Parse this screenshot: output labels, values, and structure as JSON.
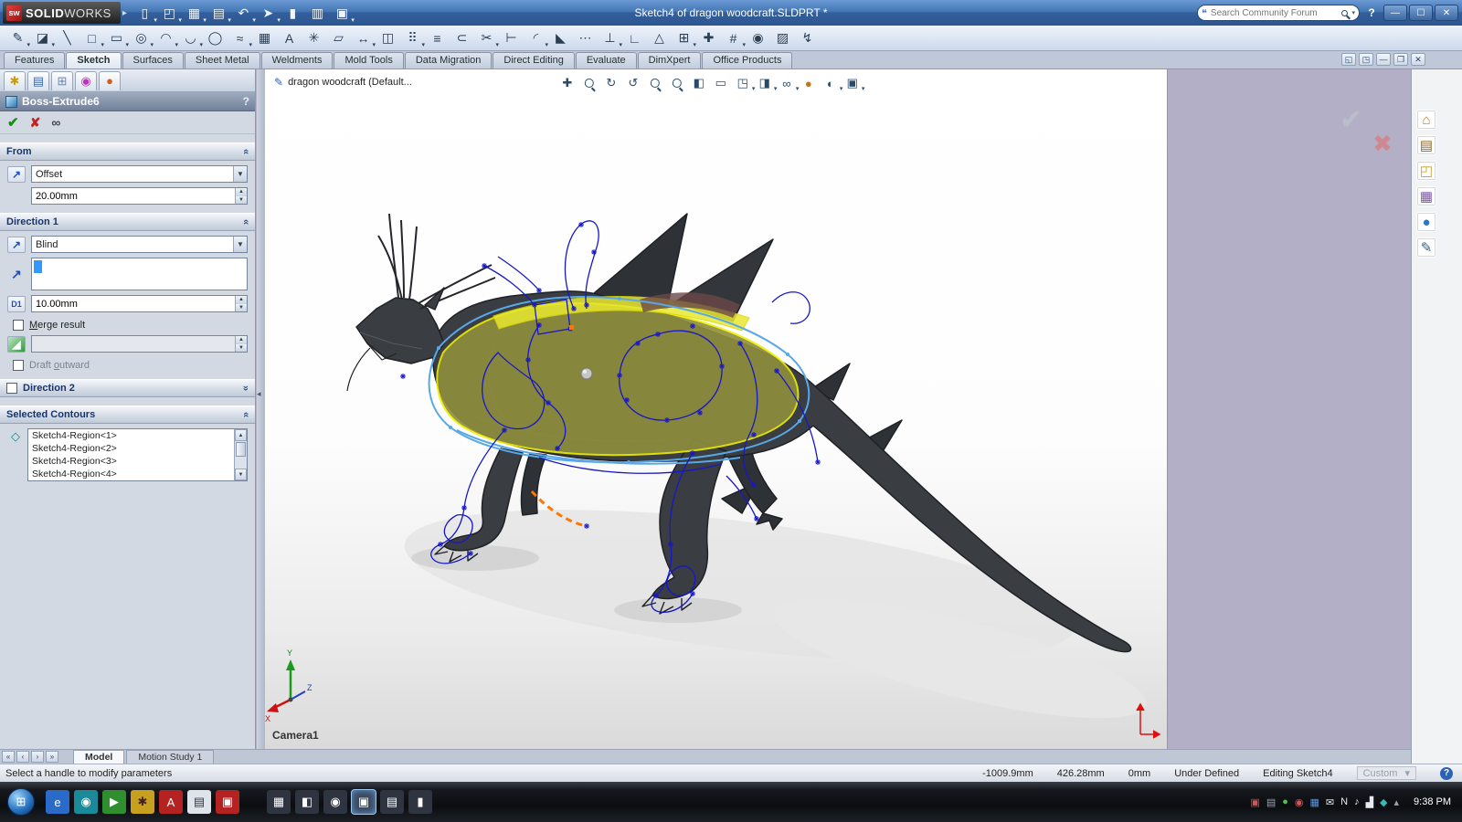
{
  "titlebar": {
    "logo": {
      "badge": "sw",
      "name_bold": "SOLID",
      "name_light": "WORKS",
      "arrow": "▸"
    },
    "doc_title": "Sketch4 of dragon woodcraft.SLDPRT *",
    "search_placeholder": "Search Community Forum",
    "bubble_glyph": "❝",
    "help_glyph": "?",
    "quick": [
      {
        "name": "new-document-icon",
        "glyph": "▯",
        "v": "arr"
      },
      {
        "name": "open-icon",
        "glyph": "◰",
        "v": "arr"
      },
      {
        "name": "save-icon",
        "glyph": "▦",
        "v": "arr"
      },
      {
        "name": "print-icon",
        "glyph": "▤",
        "v": "arr"
      },
      {
        "name": "undo-icon",
        "glyph": "↶",
        "v": "arr"
      },
      {
        "name": "select-icon",
        "glyph": "➤",
        "v": "arr"
      },
      {
        "name": "rebuild-icon",
        "glyph": "▮",
        "v": ""
      },
      {
        "name": "file-properties-icon",
        "glyph": "▥",
        "v": ""
      },
      {
        "name": "options-icon",
        "glyph": "▣",
        "v": "arr"
      }
    ],
    "window_buttons": [
      {
        "name": "minimize-button",
        "glyph": "—"
      },
      {
        "name": "maximize-button",
        "glyph": "☐"
      },
      {
        "name": "close-button",
        "glyph": "✕"
      }
    ]
  },
  "sketch_toolbar": {
    "icons": [
      {
        "name": "exit-sketch-icon",
        "glyph": "✎",
        "v": "arr"
      },
      {
        "name": "eraser-icon",
        "glyph": "◪",
        "v": "arr"
      },
      {
        "name": "line-icon",
        "glyph": "╲",
        "v": ""
      },
      {
        "name": "rectangle-icon",
        "glyph": "□",
        "v": "arr"
      },
      {
        "name": "slot-icon",
        "glyph": "▭",
        "v": "arr"
      },
      {
        "name": "circle-icon",
        "glyph": "◎",
        "v": "arr"
      },
      {
        "name": "arc-icon",
        "glyph": "◠",
        "v": "arr"
      },
      {
        "name": "three-point-arc-icon",
        "glyph": "◡",
        "v": "arr"
      },
      {
        "name": "ellipse-icon",
        "glyph": "◯",
        "v": ""
      },
      {
        "name": "spline-icon",
        "glyph": "≈",
        "v": "arr"
      },
      {
        "name": "grid-icon",
        "glyph": "▦",
        "v": ""
      },
      {
        "name": "text-icon",
        "glyph": "A",
        "v": ""
      },
      {
        "name": "point-icon",
        "glyph": "✳",
        "v": ""
      },
      {
        "name": "plane-icon",
        "glyph": "▱",
        "v": ""
      },
      {
        "name": "smart-dimension-icon",
        "glyph": "↔",
        "v": "arr"
      },
      {
        "name": "mirror-entities-icon",
        "glyph": "◫",
        "v": ""
      },
      {
        "name": "linear-pattern-icon",
        "glyph": "⠿",
        "v": "arr"
      },
      {
        "name": "offset-entities-icon",
        "glyph": "≡",
        "v": ""
      },
      {
        "name": "convert-entities-icon",
        "glyph": "⊂",
        "v": ""
      },
      {
        "name": "trim-entities-icon",
        "glyph": "✂",
        "v": "arr"
      },
      {
        "name": "extend-entities-icon",
        "glyph": "⊢",
        "v": ""
      },
      {
        "name": "fillet-icon",
        "glyph": "◜",
        "v": "arr"
      },
      {
        "name": "chamfer-icon",
        "glyph": "◣",
        "v": ""
      },
      {
        "name": "construction-geometry-icon",
        "glyph": "⋯",
        "v": ""
      },
      {
        "name": "display-relations-icon",
        "glyph": "⊥",
        "v": "arr"
      },
      {
        "name": "add-relation-icon",
        "glyph": "∟",
        "v": ""
      },
      {
        "name": "sketch-warning-icon",
        "glyph": "△",
        "v": ""
      },
      {
        "name": "pattern-icon",
        "glyph": "⊞",
        "v": "arr"
      },
      {
        "name": "snap-icon",
        "glyph": "✚",
        "v": ""
      },
      {
        "name": "quick-snaps-icon",
        "glyph": "#",
        "v": "arr"
      },
      {
        "name": "record-macro-icon",
        "glyph": "◉",
        "v": "red"
      },
      {
        "name": "sketch-picture-icon",
        "glyph": "▨",
        "v": ""
      },
      {
        "name": "instant3d-icon",
        "glyph": "↯",
        "v": "yellow"
      }
    ]
  },
  "ribbon": {
    "tabs": [
      {
        "label": "Features",
        "v": ""
      },
      {
        "label": "Sketch",
        "v": "active"
      },
      {
        "label": "Surfaces",
        "v": ""
      },
      {
        "label": "Sheet Metal",
        "v": ""
      },
      {
        "label": "Weldments",
        "v": ""
      },
      {
        "label": "Mold Tools",
        "v": ""
      },
      {
        "label": "Data Migration",
        "v": ""
      },
      {
        "label": "Direct Editing",
        "v": ""
      },
      {
        "label": "Evaluate",
        "v": ""
      },
      {
        "label": "DimXpert",
        "v": ""
      },
      {
        "label": "Office Products",
        "v": ""
      }
    ],
    "child_controls": [
      {
        "name": "dock-pane-icon",
        "glyph": "◱"
      },
      {
        "name": "expand-pane-icon",
        "glyph": "◳"
      },
      {
        "name": "child-minimize-button",
        "glyph": "—"
      },
      {
        "name": "child-restore-button",
        "glyph": "❐"
      },
      {
        "name": "child-close-button",
        "glyph": "✕"
      }
    ]
  },
  "property_manager": {
    "tab_icons": [
      {
        "name": "feature-manager-tab",
        "glyph": "✱",
        "color": "#c89c10"
      },
      {
        "name": "property-manager-tab",
        "glyph": "▤",
        "color": "#3a68a8"
      },
      {
        "name": "configuration-manager-tab",
        "glyph": "⊞",
        "color": "#6a85ad"
      },
      {
        "name": "dimxpert-manager-tab",
        "glyph": "◉",
        "color": "#c030c0"
      },
      {
        "name": "display-manager-tab",
        "glyph": "●",
        "color": "#d06020"
      }
    ],
    "header": {
      "title": "Boss-Extrude6",
      "help": "?"
    },
    "actions": {
      "ok": "✔",
      "cancel": "✘",
      "preview": "∞"
    },
    "from": {
      "label": "From",
      "option": "Offset",
      "offset_value": "20.00mm"
    },
    "direction1": {
      "label": "Direction 1",
      "option": "Blind",
      "dir_arrow": "↗",
      "depth_icon": "D1",
      "depth_value": "10.00mm",
      "merge": {
        "pre": "",
        "k": "M",
        "rest": "erge result"
      },
      "draft": {
        "pre": "Draft ",
        "k": "o",
        "rest": "utward"
      }
    },
    "direction2": {
      "label": "Direction 2"
    },
    "contours": {
      "label": "Selected Contours",
      "items": [
        "Sketch4-Region<1>",
        "Sketch4-Region<2>",
        "Sketch4-Region<3>",
        "Sketch4-Region<4>"
      ]
    }
  },
  "viewport": {
    "breadcrumb": "dragon woodcraft  (Default...",
    "camera_label": "Camera1",
    "triad": {
      "x": "X",
      "y": "Y",
      "z": "Z"
    },
    "hud": [
      {
        "name": "pan-icon",
        "glyph": "✚",
        "v": ""
      },
      {
        "name": "zoom-fit-icon",
        "glyph": "",
        "v": "mag"
      },
      {
        "name": "rotate-view-icon",
        "glyph": "↻",
        "v": ""
      },
      {
        "name": "previous-view-icon",
        "glyph": "↺",
        "v": ""
      },
      {
        "name": "zoom-area-icon",
        "glyph": "",
        "v": "mag"
      },
      {
        "name": "zoom-in-out-icon",
        "glyph": "",
        "v": "mag"
      },
      {
        "name": "section-view-icon",
        "glyph": "◧",
        "v": ""
      },
      {
        "name": "annotation-icon",
        "glyph": "▭",
        "v": ""
      },
      {
        "name": "view-orientation-icon",
        "glyph": "◳",
        "v": "arr"
      },
      {
        "name": "display-style-icon",
        "glyph": "◨",
        "v": "arr"
      },
      {
        "name": "hide-show-items-icon",
        "glyph": "∞",
        "v": "arr"
      },
      {
        "name": "edit-appearance-icon",
        "glyph": "●",
        "v": "ball"
      },
      {
        "name": "apply-scene-icon",
        "glyph": "◐",
        "v": "arr"
      },
      {
        "name": "view-settings-icon",
        "glyph": "▣",
        "v": "arr"
      }
    ]
  },
  "right_gap": {
    "ghost_check": "✔",
    "ghost_x": "✖"
  },
  "task_pane": {
    "icons": [
      {
        "name": "solidworks-resources-icon",
        "glyph": "⌂",
        "color": "#c87616"
      },
      {
        "name": "design-library-icon",
        "glyph": "▤",
        "color": "#8a6420"
      },
      {
        "name": "file-explorer-icon",
        "glyph": "◰",
        "color": "#c8a020"
      },
      {
        "name": "view-palette-icon",
        "glyph": "▦",
        "color": "#7a55a8"
      },
      {
        "name": "appearances-icon",
        "glyph": "●",
        "color": "#2878c8"
      },
      {
        "name": "custom-properties-icon",
        "glyph": "✎",
        "color": "#3a6080"
      }
    ]
  },
  "doc_tabs": {
    "nav": [
      {
        "name": "first-tab-button",
        "glyph": "«"
      },
      {
        "name": "prev-tab-button",
        "glyph": "‹"
      },
      {
        "name": "next-tab-button",
        "glyph": "›"
      },
      {
        "name": "last-tab-button",
        "glyph": "»"
      }
    ],
    "tabs": [
      {
        "label": "Model",
        "v": "active"
      },
      {
        "label": "Motion Study 1",
        "v": ""
      }
    ]
  },
  "statusbar": {
    "message": "Select a handle to modify parameters",
    "x": "-1009.9mm",
    "y": "426.28mm",
    "z": "0mm",
    "constraint_state": "Under Defined",
    "editing": "Editing Sketch4",
    "combo": "Custom",
    "combo_arrow": "▾",
    "help": "?"
  },
  "taskbar": {
    "start_glyph": "⊞",
    "quick": [
      {
        "name": "internet-explorer-icon",
        "glyph": "e",
        "v": "blue"
      },
      {
        "name": "network-places-icon",
        "glyph": "◉",
        "v": "teal"
      },
      {
        "name": "media-player-icon",
        "glyph": "▶",
        "v": "green"
      },
      {
        "name": "messenger-icon",
        "glyph": "✱",
        "v": "yellow"
      },
      {
        "name": "acrobat-icon",
        "glyph": "A",
        "v": "red"
      },
      {
        "name": "notes-app-icon",
        "glyph": "▤",
        "v": "lightbg"
      },
      {
        "name": "solidworks-launch-icon",
        "glyph": "▣",
        "v": "red"
      }
    ],
    "apps": [
      {
        "name": "explorer-window-button",
        "glyph": "▦",
        "v": "dark"
      },
      {
        "name": "app-window-2-button",
        "glyph": "◧",
        "v": "dark"
      },
      {
        "name": "app-window-3-button",
        "glyph": "◉",
        "v": "dark"
      },
      {
        "name": "solidworks-window-button",
        "glyph": "▣",
        "v": "active red"
      },
      {
        "name": "app-window-5-button",
        "glyph": "▤",
        "v": "dark"
      },
      {
        "name": "terminal-window-button",
        "glyph": "▮",
        "v": "dark"
      }
    ],
    "tray": [
      {
        "name": "tray-solidworks-icon",
        "glyph": "▣",
        "v": "red"
      },
      {
        "name": "tray-doc-icon",
        "glyph": "▤",
        "v": "gray"
      },
      {
        "name": "tray-sync-icon",
        "glyph": "●",
        "v": "green"
      },
      {
        "name": "tray-alert-icon",
        "glyph": "◉",
        "v": "red"
      },
      {
        "name": "tray-display-icon",
        "glyph": "▦",
        "v": "blue"
      },
      {
        "name": "tray-mail-icon",
        "glyph": "✉",
        "v": ""
      },
      {
        "name": "tray-onenote-icon",
        "glyph": "N",
        "v": ""
      },
      {
        "name": "tray-volume-icon",
        "glyph": "♪",
        "v": ""
      },
      {
        "name": "tray-network-icon",
        "glyph": "▟",
        "v": ""
      },
      {
        "name": "tray-shield-icon",
        "glyph": "◆",
        "v": "teal"
      },
      {
        "name": "tray-hidden-icons",
        "glyph": "▴",
        "v": "gray"
      }
    ],
    "time": "9:38 PM"
  }
}
